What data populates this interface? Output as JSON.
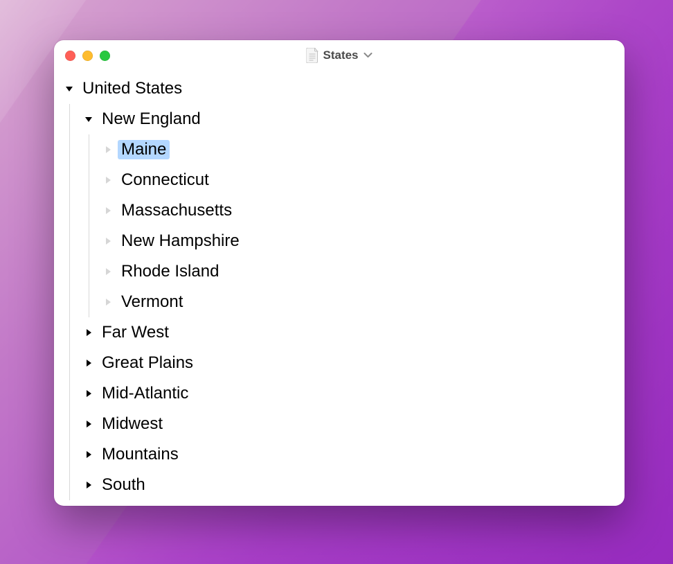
{
  "window": {
    "title": "States"
  },
  "tree": {
    "root": {
      "label": "United States",
      "expanded": true,
      "children": [
        {
          "label": "New England",
          "expanded": true,
          "children": [
            {
              "label": "Maine",
              "selected": true
            },
            {
              "label": "Connecticut"
            },
            {
              "label": "Massachusetts"
            },
            {
              "label": "New Hampshire"
            },
            {
              "label": "Rhode Island"
            },
            {
              "label": "Vermont"
            }
          ]
        },
        {
          "label": "Far West",
          "expanded": false
        },
        {
          "label": "Great Plains",
          "expanded": false
        },
        {
          "label": "Mid-Atlantic",
          "expanded": false
        },
        {
          "label": "Midwest",
          "expanded": false
        },
        {
          "label": "Mountains",
          "expanded": false
        },
        {
          "label": "South",
          "expanded": false
        }
      ]
    }
  }
}
